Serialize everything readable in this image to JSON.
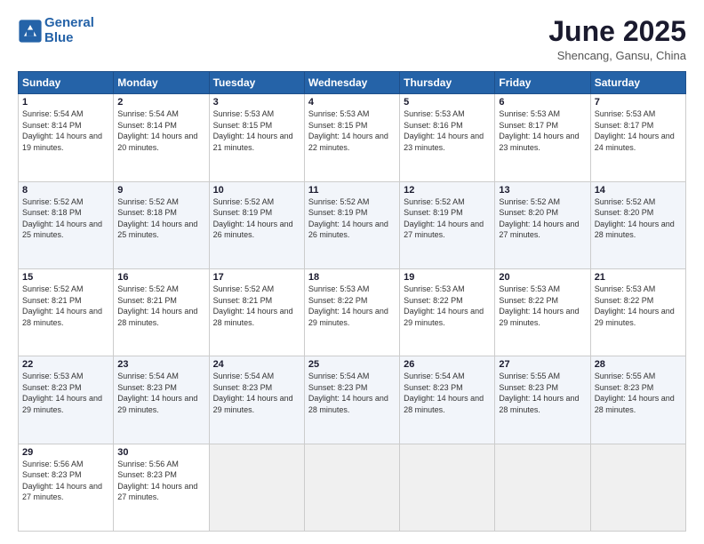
{
  "logo": {
    "line1": "General",
    "line2": "Blue"
  },
  "header": {
    "month": "June 2025",
    "location": "Shencang, Gansu, China"
  },
  "weekdays": [
    "Sunday",
    "Monday",
    "Tuesday",
    "Wednesday",
    "Thursday",
    "Friday",
    "Saturday"
  ],
  "weeks": [
    [
      {
        "day": "1",
        "sunrise": "5:54 AM",
        "sunset": "8:14 PM",
        "daylight": "14 hours and 19 minutes."
      },
      {
        "day": "2",
        "sunrise": "5:54 AM",
        "sunset": "8:14 PM",
        "daylight": "14 hours and 20 minutes."
      },
      {
        "day": "3",
        "sunrise": "5:53 AM",
        "sunset": "8:15 PM",
        "daylight": "14 hours and 21 minutes."
      },
      {
        "day": "4",
        "sunrise": "5:53 AM",
        "sunset": "8:15 PM",
        "daylight": "14 hours and 22 minutes."
      },
      {
        "day": "5",
        "sunrise": "5:53 AM",
        "sunset": "8:16 PM",
        "daylight": "14 hours and 23 minutes."
      },
      {
        "day": "6",
        "sunrise": "5:53 AM",
        "sunset": "8:17 PM",
        "daylight": "14 hours and 23 minutes."
      },
      {
        "day": "7",
        "sunrise": "5:53 AM",
        "sunset": "8:17 PM",
        "daylight": "14 hours and 24 minutes."
      }
    ],
    [
      {
        "day": "8",
        "sunrise": "5:52 AM",
        "sunset": "8:18 PM",
        "daylight": "14 hours and 25 minutes."
      },
      {
        "day": "9",
        "sunrise": "5:52 AM",
        "sunset": "8:18 PM",
        "daylight": "14 hours and 25 minutes."
      },
      {
        "day": "10",
        "sunrise": "5:52 AM",
        "sunset": "8:19 PM",
        "daylight": "14 hours and 26 minutes."
      },
      {
        "day": "11",
        "sunrise": "5:52 AM",
        "sunset": "8:19 PM",
        "daylight": "14 hours and 26 minutes."
      },
      {
        "day": "12",
        "sunrise": "5:52 AM",
        "sunset": "8:19 PM",
        "daylight": "14 hours and 27 minutes."
      },
      {
        "day": "13",
        "sunrise": "5:52 AM",
        "sunset": "8:20 PM",
        "daylight": "14 hours and 27 minutes."
      },
      {
        "day": "14",
        "sunrise": "5:52 AM",
        "sunset": "8:20 PM",
        "daylight": "14 hours and 28 minutes."
      }
    ],
    [
      {
        "day": "15",
        "sunrise": "5:52 AM",
        "sunset": "8:21 PM",
        "daylight": "14 hours and 28 minutes."
      },
      {
        "day": "16",
        "sunrise": "5:52 AM",
        "sunset": "8:21 PM",
        "daylight": "14 hours and 28 minutes."
      },
      {
        "day": "17",
        "sunrise": "5:52 AM",
        "sunset": "8:21 PM",
        "daylight": "14 hours and 28 minutes."
      },
      {
        "day": "18",
        "sunrise": "5:53 AM",
        "sunset": "8:22 PM",
        "daylight": "14 hours and 29 minutes."
      },
      {
        "day": "19",
        "sunrise": "5:53 AM",
        "sunset": "8:22 PM",
        "daylight": "14 hours and 29 minutes."
      },
      {
        "day": "20",
        "sunrise": "5:53 AM",
        "sunset": "8:22 PM",
        "daylight": "14 hours and 29 minutes."
      },
      {
        "day": "21",
        "sunrise": "5:53 AM",
        "sunset": "8:22 PM",
        "daylight": "14 hours and 29 minutes."
      }
    ],
    [
      {
        "day": "22",
        "sunrise": "5:53 AM",
        "sunset": "8:23 PM",
        "daylight": "14 hours and 29 minutes."
      },
      {
        "day": "23",
        "sunrise": "5:54 AM",
        "sunset": "8:23 PM",
        "daylight": "14 hours and 29 minutes."
      },
      {
        "day": "24",
        "sunrise": "5:54 AM",
        "sunset": "8:23 PM",
        "daylight": "14 hours and 29 minutes."
      },
      {
        "day": "25",
        "sunrise": "5:54 AM",
        "sunset": "8:23 PM",
        "daylight": "14 hours and 28 minutes."
      },
      {
        "day": "26",
        "sunrise": "5:54 AM",
        "sunset": "8:23 PM",
        "daylight": "14 hours and 28 minutes."
      },
      {
        "day": "27",
        "sunrise": "5:55 AM",
        "sunset": "8:23 PM",
        "daylight": "14 hours and 28 minutes."
      },
      {
        "day": "28",
        "sunrise": "5:55 AM",
        "sunset": "8:23 PM",
        "daylight": "14 hours and 28 minutes."
      }
    ],
    [
      {
        "day": "29",
        "sunrise": "5:56 AM",
        "sunset": "8:23 PM",
        "daylight": "14 hours and 27 minutes."
      },
      {
        "day": "30",
        "sunrise": "5:56 AM",
        "sunset": "8:23 PM",
        "daylight": "14 hours and 27 minutes."
      },
      null,
      null,
      null,
      null,
      null
    ]
  ]
}
